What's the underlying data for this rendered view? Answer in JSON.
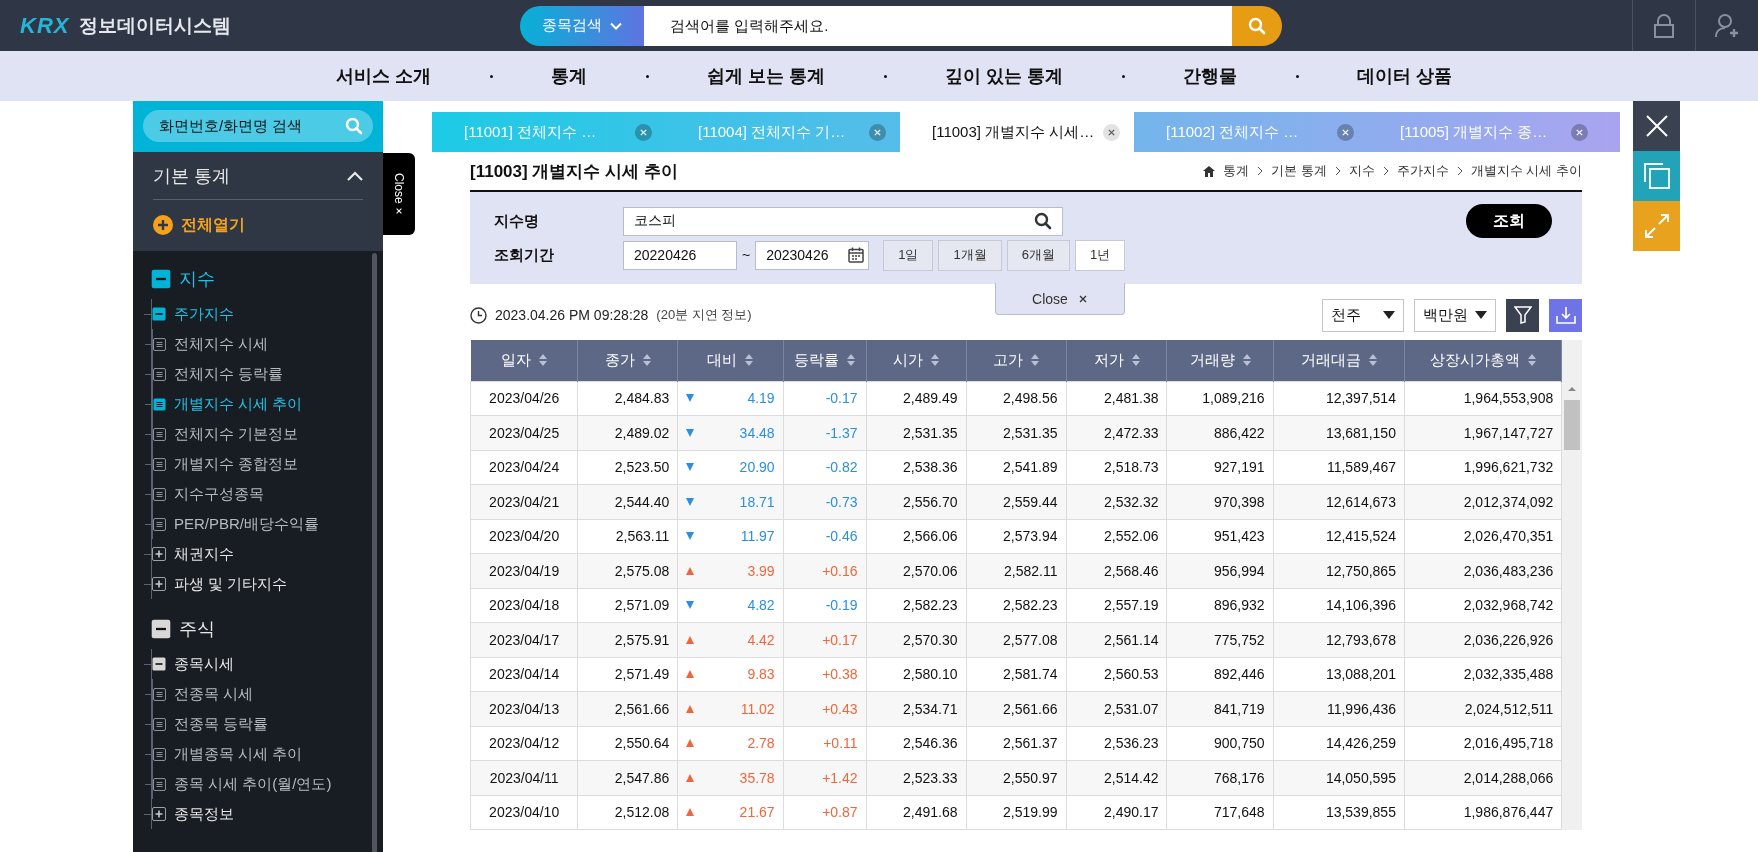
{
  "header": {
    "logo": "KRX",
    "title": "정보데이터시스템",
    "search": {
      "category": "종목검색",
      "placeholder": "검색어를 입력해주세요."
    }
  },
  "nav": [
    "서비스 소개",
    "통계",
    "쉽게 보는 통계",
    "깊이 있는 통계",
    "간행물",
    "데이터 상품"
  ],
  "sidebar": {
    "search_placeholder": "화면번호/화면명 검색",
    "section": "기본 통계",
    "expanded": true,
    "open_all": "전체열기",
    "close_tab": "Close",
    "tree": [
      {
        "label": "지수",
        "kind": "group",
        "expanded": true,
        "children": [
          {
            "label": "주가지수",
            "kind": "folder",
            "expanded": true,
            "children": [
              {
                "label": "전체지수 시세",
                "kind": "page",
                "selected": false
              },
              {
                "label": "전체지수 등락률",
                "kind": "page",
                "selected": false
              },
              {
                "label": "개별지수 시세 추이",
                "kind": "page",
                "selected": true
              },
              {
                "label": "전체지수 기본정보",
                "kind": "page",
                "selected": false
              },
              {
                "label": "개별지수 종합정보",
                "kind": "page",
                "selected": false
              },
              {
                "label": "지수구성종목",
                "kind": "page",
                "selected": false
              },
              {
                "label": "PER/PBR/배당수익률",
                "kind": "page",
                "selected": false
              }
            ]
          },
          {
            "label": "채권지수",
            "kind": "folder",
            "expanded": false
          },
          {
            "label": "파생 및 기타지수",
            "kind": "folder",
            "expanded": false
          }
        ]
      },
      {
        "label": "주식",
        "kind": "group",
        "expanded": true,
        "children": [
          {
            "label": "종목시세",
            "kind": "folder",
            "expanded": true,
            "children": [
              {
                "label": "전종목 시세",
                "kind": "page",
                "selected": false
              },
              {
                "label": "전종목 등락률",
                "kind": "page",
                "selected": false
              },
              {
                "label": "개별종목 시세 추이",
                "kind": "page",
                "selected": false
              },
              {
                "label": "종목 시세 추이(월/연도)",
                "kind": "page",
                "selected": false
              }
            ]
          },
          {
            "label": "종목정보",
            "kind": "folder",
            "expanded": false
          }
        ]
      }
    ]
  },
  "tabs": [
    {
      "label": "[11001] 전체지수 …",
      "selected": false
    },
    {
      "label": "[11004] 전체지수 기…",
      "selected": false
    },
    {
      "label": "[11003] 개별지수 시세…",
      "selected": true
    },
    {
      "label": "[11002] 전체지수 …",
      "selected": false
    },
    {
      "label": "[11005] 개별지수 종…",
      "selected": false
    }
  ],
  "page": {
    "title": "[11003] 개별지수 시세 추이",
    "breadcrumb": [
      "통계",
      "기본 통계",
      "지수",
      "주가지수",
      "개별지수 시세 추이"
    ]
  },
  "filter": {
    "index_label": "지수명",
    "index_value": "코스피",
    "period_label": "조회기간",
    "from": "20220426",
    "separator": "~",
    "to": "20230426",
    "periods": [
      {
        "label": "1일",
        "selected": false
      },
      {
        "label": "1개월",
        "selected": false
      },
      {
        "label": "6개월",
        "selected": false
      },
      {
        "label": "1년",
        "selected": true
      }
    ],
    "submit": "조회",
    "close": "Close"
  },
  "info": {
    "timestamp": "2023.04.26 PM 09:28:28",
    "note": "(20분 지연 정보)",
    "unit_volume": "천주",
    "unit_value": "백만원"
  },
  "table": {
    "columns": [
      "일자",
      "종가",
      "대비",
      "등락률",
      "시가",
      "고가",
      "저가",
      "거래량",
      "거래대금",
      "상장시가총액"
    ],
    "rows": [
      {
        "kind": "down",
        "cells": [
          "2023/04/26",
          "2,484.83",
          "4.19",
          "-0.17",
          "2,489.49",
          "2,498.56",
          "2,481.38",
          "1,089,216",
          "12,397,514",
          "1,964,553,908"
        ]
      },
      {
        "kind": "down",
        "cells": [
          "2023/04/25",
          "2,489.02",
          "34.48",
          "-1.37",
          "2,531.35",
          "2,531.35",
          "2,472.33",
          "886,422",
          "13,681,150",
          "1,967,147,727"
        ]
      },
      {
        "kind": "down",
        "cells": [
          "2023/04/24",
          "2,523.50",
          "20.90",
          "-0.82",
          "2,538.36",
          "2,541.89",
          "2,518.73",
          "927,191",
          "11,589,467",
          "1,996,621,732"
        ]
      },
      {
        "kind": "down",
        "cells": [
          "2023/04/21",
          "2,544.40",
          "18.71",
          "-0.73",
          "2,556.70",
          "2,559.44",
          "2,532.32",
          "970,398",
          "12,614,673",
          "2,012,374,092"
        ]
      },
      {
        "kind": "down",
        "cells": [
          "2023/04/20",
          "2,563.11",
          "11.97",
          "-0.46",
          "2,566.06",
          "2,573.94",
          "2,552.06",
          "951,423",
          "12,415,524",
          "2,026,470,351"
        ]
      },
      {
        "kind": "up",
        "cells": [
          "2023/04/19",
          "2,575.08",
          "3.99",
          "+0.16",
          "2,570.06",
          "2,582.11",
          "2,568.46",
          "956,994",
          "12,750,865",
          "2,036,483,236"
        ]
      },
      {
        "kind": "down",
        "cells": [
          "2023/04/18",
          "2,571.09",
          "4.82",
          "-0.19",
          "2,582.23",
          "2,582.23",
          "2,557.19",
          "896,932",
          "14,106,396",
          "2,032,968,742"
        ]
      },
      {
        "kind": "up",
        "cells": [
          "2023/04/17",
          "2,575.91",
          "4.42",
          "+0.17",
          "2,570.30",
          "2,577.08",
          "2,561.14",
          "775,752",
          "12,793,678",
          "2,036,226,926"
        ]
      },
      {
        "kind": "up",
        "cells": [
          "2023/04/14",
          "2,571.49",
          "9.83",
          "+0.38",
          "2,580.10",
          "2,581.74",
          "2,560.53",
          "892,446",
          "13,088,201",
          "2,032,335,488"
        ]
      },
      {
        "kind": "up",
        "cells": [
          "2023/04/13",
          "2,561.66",
          "11.02",
          "+0.43",
          "2,534.71",
          "2,561.66",
          "2,531.07",
          "841,719",
          "11,996,436",
          "2,024,512,511"
        ]
      },
      {
        "kind": "up",
        "cells": [
          "2023/04/12",
          "2,550.64",
          "2.78",
          "+0.11",
          "2,546.36",
          "2,561.37",
          "2,536.23",
          "900,750",
          "14,426,259",
          "2,016,495,718"
        ]
      },
      {
        "kind": "up",
        "cells": [
          "2023/04/11",
          "2,547.86",
          "35.78",
          "+1.42",
          "2,523.33",
          "2,550.97",
          "2,514.42",
          "768,176",
          "14,050,595",
          "2,014,288,066"
        ]
      },
      {
        "kind": "up",
        "cells": [
          "2023/04/10",
          "2,512.08",
          "21.67",
          "+0.87",
          "2,491.68",
          "2,519.99",
          "2,490.17",
          "717,648",
          "13,539,855",
          "1,986,876,447"
        ]
      }
    ]
  }
}
